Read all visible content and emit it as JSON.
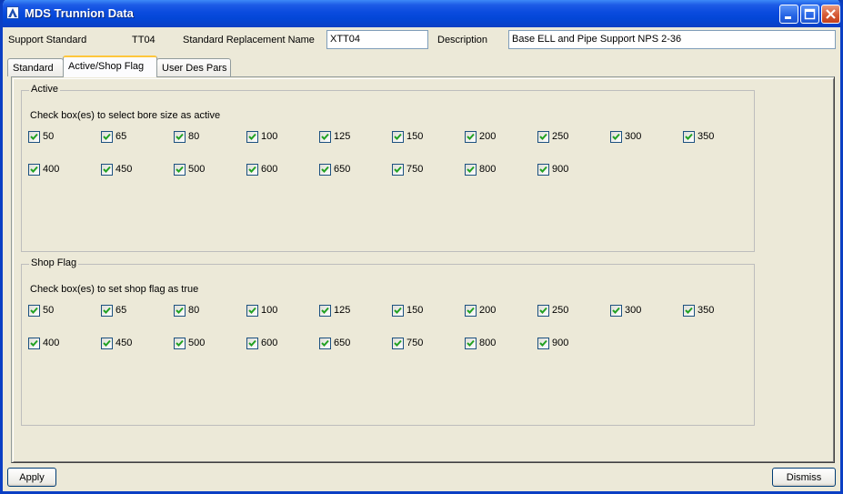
{
  "window": {
    "title": "MDS Trunnion Data"
  },
  "header": {
    "support_standard_label": "Support Standard",
    "support_standard_value": "TT04",
    "replacement_name_label": "Standard Replacement Name",
    "replacement_name_value": "XTT04",
    "description_label": "Description",
    "description_value": "Base ELL and Pipe Support NPS 2-36"
  },
  "tabs": [
    {
      "label": "Standard",
      "active": false
    },
    {
      "label": "Active/Shop Flag",
      "active": true
    },
    {
      "label": "User Des Pars",
      "active": false
    }
  ],
  "active_group": {
    "title": "Active",
    "hint": "Check box(es) to select bore size as active",
    "sizes": [
      "50",
      "65",
      "80",
      "100",
      "125",
      "150",
      "200",
      "250",
      "300",
      "350",
      "400",
      "450",
      "500",
      "600",
      "650",
      "750",
      "800",
      "900"
    ],
    "checked": true
  },
  "shop_group": {
    "title": "Shop Flag",
    "hint": "Check box(es) to set shop flag as true",
    "sizes": [
      "50",
      "65",
      "80",
      "100",
      "125",
      "150",
      "200",
      "250",
      "300",
      "350",
      "400",
      "450",
      "500",
      "600",
      "650",
      "750",
      "800",
      "900"
    ],
    "checked": true
  },
  "footer": {
    "apply_label": "Apply",
    "dismiss_label": "Dismiss"
  },
  "colors": {
    "title_bar": "#0a4bde",
    "window_bg": "#ece9d8",
    "check": "#21a121",
    "tab_highlight": "#ffc73c"
  }
}
